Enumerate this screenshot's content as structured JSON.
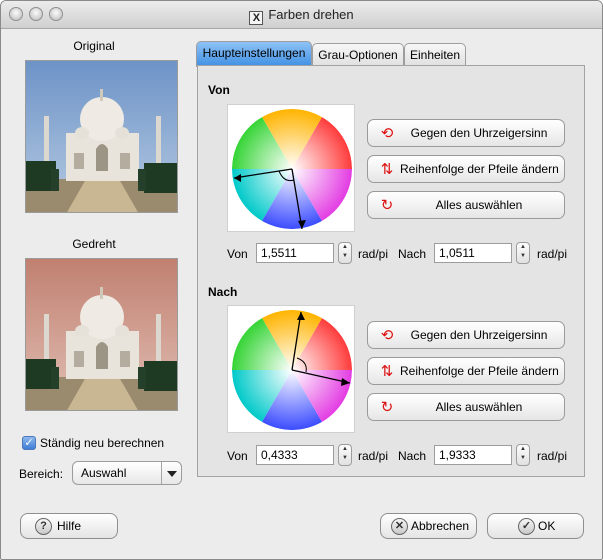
{
  "window": {
    "title": "Farben drehen",
    "title_icon": "x-icon"
  },
  "left_panel": {
    "original_label": "Original",
    "rotated_label": "Gedreht",
    "recalculate_checkbox": {
      "label": "Ständig neu berechnen",
      "checked": true
    },
    "range_label": "Bereich:",
    "range_select": {
      "value": "Auswahl"
    }
  },
  "tabs": [
    {
      "label": "Haupteinstellungen",
      "active": true
    },
    {
      "label": "Grau-Optionen",
      "active": false
    },
    {
      "label": "Einheiten",
      "active": false
    }
  ],
  "from_section": {
    "title": "Von",
    "buttons": {
      "counterclockwise": "Gegen den Uhrzeigersinn",
      "change_arrow_order": "Reihenfolge der Pfeile ändern",
      "select_all": "Alles auswählen"
    },
    "from_label": "Von",
    "from_value": "1,5511",
    "from_unit": "rad/pi",
    "to_label": "Nach",
    "to_value": "1,0511",
    "to_unit": "rad/pi"
  },
  "to_section": {
    "title": "Nach",
    "buttons": {
      "counterclockwise": "Gegen den Uhrzeigersinn",
      "change_arrow_order": "Reihenfolge der Pfeile ändern",
      "select_all": "Alles auswählen"
    },
    "from_label": "Von",
    "from_value": "0,4333",
    "from_unit": "rad/pi",
    "to_label": "Nach",
    "to_value": "1,9333",
    "to_unit": "rad/pi"
  },
  "footer": {
    "help_label": "Hilfe",
    "help_icon_text": "?",
    "cancel_label": "Abbrechen",
    "ok_label": "OK"
  },
  "colors": {
    "active_tab": "#3e8fe3",
    "arrow_icon": "#d11111"
  }
}
